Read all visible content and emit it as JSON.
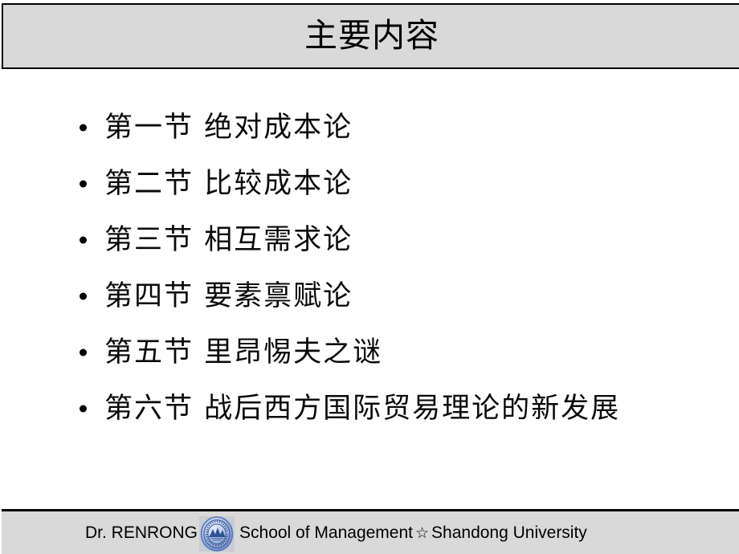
{
  "slide": {
    "title": "主要内容",
    "background_color": "#ffffff",
    "bar_color": "#d9d9d9",
    "text_color": "#000000"
  },
  "body": {
    "bullets": [
      {
        "label": "第一节  绝对成本论"
      },
      {
        "label": "第二节  比较成本论"
      },
      {
        "label": "第三节  相互需求论"
      },
      {
        "label": "第四节  要素禀赋论"
      },
      {
        "label": "第五节  里昂惕夫之谜"
      },
      {
        "label": "第六节  战后西方国际贸易理论的新发展"
      }
    ]
  },
  "footer": {
    "author": "Dr. RENRONG",
    "logo_icon": "shandong-university-seal-icon",
    "logo_color": "#4a6fb5",
    "institution": "School of Management",
    "separator": "☆",
    "university": "Shandong  University"
  }
}
